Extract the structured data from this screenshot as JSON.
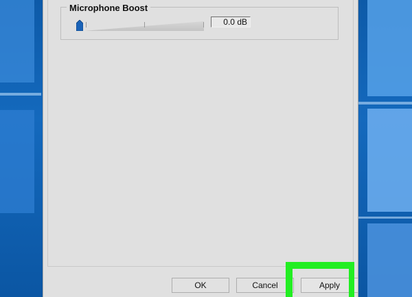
{
  "dialog": {
    "group_title": "Microphone Boost",
    "boost_value": "0.0 dB",
    "boost_level_fraction": 0.0
  },
  "buttons": {
    "ok": "OK",
    "cancel": "Cancel",
    "apply": "Apply"
  },
  "colors": {
    "highlight": "#22ee22",
    "slider_thumb": "#1a63b8",
    "dialog_bg": "#e0e0e0",
    "desktop_bg": "#1469bd"
  },
  "icons": {
    "slider_thumb": "slider-thumb-icon"
  }
}
